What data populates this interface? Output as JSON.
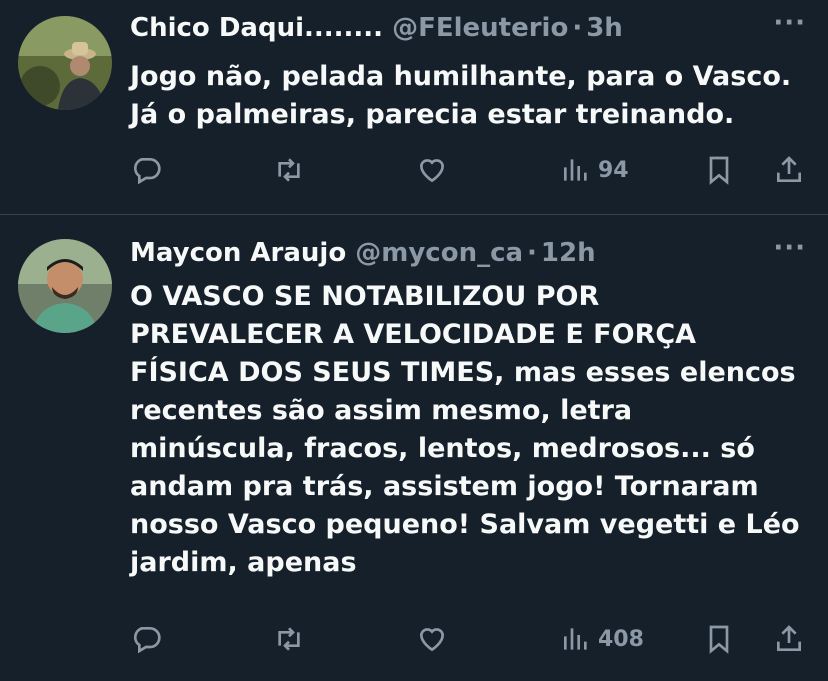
{
  "tweets": [
    {
      "display_name": "Chico Daqui........",
      "handle": "@FEleuterio",
      "separator": "·",
      "time": "3h",
      "more": "···",
      "lines": [
        "Jogo não, pelada humilhante, para o Vasco.",
        "Já o palmeiras, parecia estar treinando."
      ],
      "views": "94",
      "icons": [
        "reply-icon",
        "retweet-icon",
        "like-icon",
        "views-icon",
        "bookmark-icon",
        "share-icon"
      ]
    },
    {
      "display_name": "Maycon Araujo",
      "handle": "@mycon_ca",
      "separator": "·",
      "time": "12h",
      "more": "···",
      "lines": [
        "O VASCO SE NOTABILIZOU POR",
        "PREVALECER A VELOCIDADE E FORÇA",
        "FÍSICA DOS SEUS TIMES, mas esses elencos",
        "recentes são assim mesmo, letra",
        "minúscula, fracos, lentos, medrosos... só",
        "andam pra trás, assistem jogo! Tornaram",
        "nosso Vasco pequeno! Salvam vegetti e Léo",
        "jardim, apenas"
      ],
      "views": "408",
      "icons": [
        "reply-icon",
        "retweet-icon",
        "like-icon",
        "views-icon",
        "bookmark-icon",
        "share-icon"
      ]
    }
  ],
  "colors": {
    "background": "#15202b",
    "text": "#f7f9f9",
    "muted": "#8b98a5",
    "divider": "#38444d"
  }
}
